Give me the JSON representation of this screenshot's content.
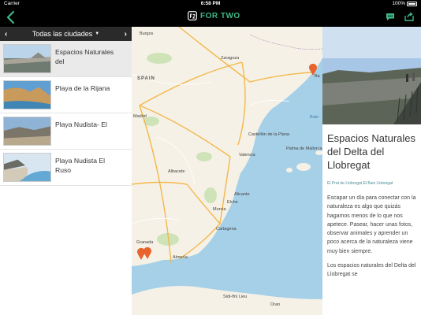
{
  "statusbar": {
    "carrier": "Carrier",
    "time": "6:58 PM",
    "battery": "100%"
  },
  "header": {
    "brand_mark": "f2",
    "brand_text": "FOR TWO",
    "colors": {
      "brand": "#3cb886",
      "nav_bg": "#000000"
    }
  },
  "sidebar": {
    "city_selector": "Todas las ciudades",
    "items": [
      {
        "title": "Espacios Naturales del",
        "selected": true
      },
      {
        "title": "Playa de la Rijana",
        "selected": false
      },
      {
        "title": "Playa Nudista- El",
        "selected": false
      },
      {
        "title": "Playa Nudista El Ruso",
        "selected": false
      }
    ]
  },
  "map": {
    "labels": {
      "burgos": "Burgos",
      "zaragoza": "Zaragoza",
      "spain": "SPAIN",
      "madrid": "Madrid",
      "castellon": "Castellón de la Plana",
      "palma": "Palma de Mallorca",
      "valencia": "Valencia",
      "albacete": "Albacete",
      "alicante": "Alicante",
      "elche": "Elche",
      "murcia": "Murcia",
      "cartagena": "Cartagena",
      "granada": "Granada",
      "almeria": "Almería",
      "sidi": "Sidi-Ifni Lieu",
      "oran": "Oran",
      "bcn": "Ba",
      "sea": "Bale"
    },
    "pin_color": "#e8642c"
  },
  "detail": {
    "title": "Espacios Naturales del Delta del Llobregat",
    "tags": "El Prat de Llobregat El Baix Llobregat",
    "paragraphs": [
      "Escapar un día para conectar con la naturaleza es algo que quizás hagamos menos de lo que nos apetece. Pasear, hacer unas fotos, observar animales y aprender un poco acerca de la naturaleza viene muy bien siempre.",
      "Los espacios naturales del Delta del Llobregat se"
    ]
  }
}
